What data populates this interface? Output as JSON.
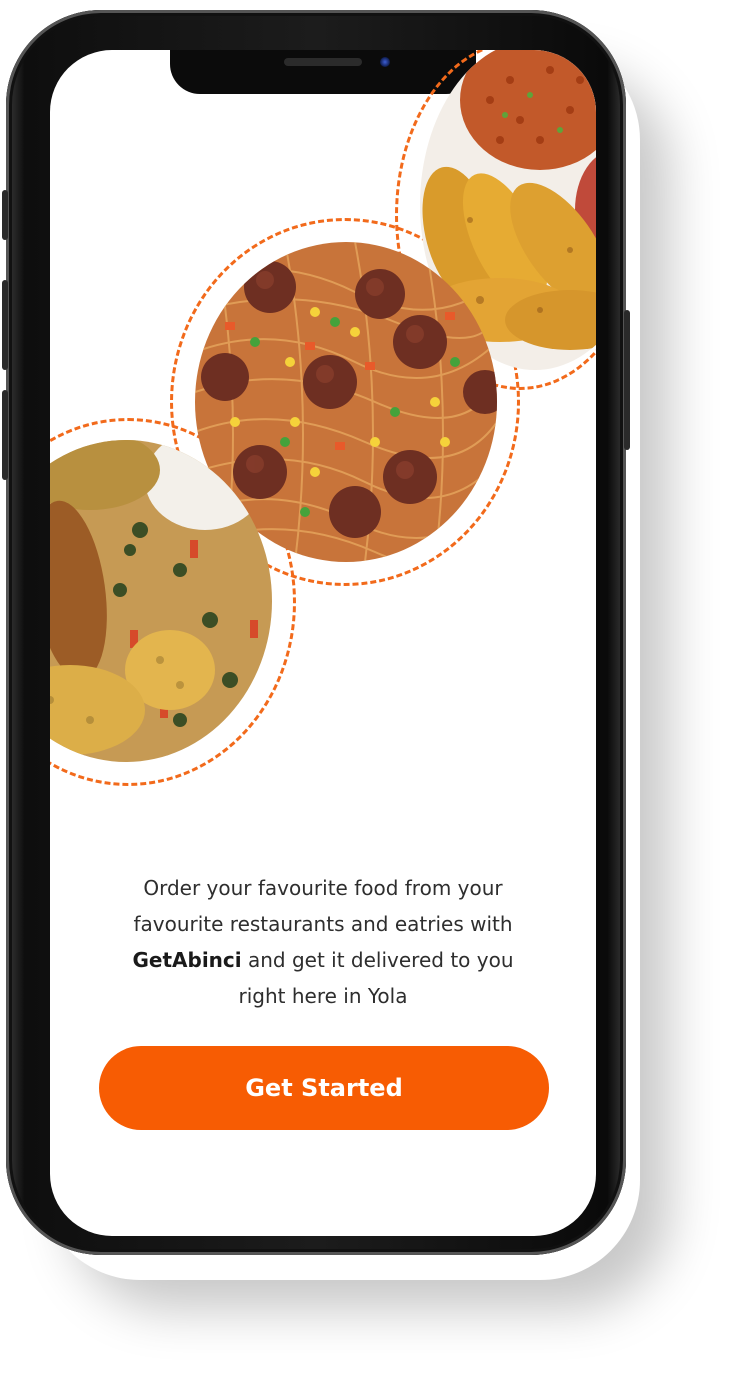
{
  "onboarding": {
    "description_part1": "Order your favourite food from your favourite restaurants and eatries with ",
    "brand_name": "GetAbinci",
    "description_part2": " and get it delivered to you right here in Yola",
    "cta_label": "Get Started"
  },
  "colors": {
    "accent": "#f75c03",
    "dash": "#f26a1b"
  },
  "images": [
    {
      "name": "jollof-rice-plantain-image"
    },
    {
      "name": "spaghetti-meatballs-image"
    },
    {
      "name": "egusi-soup-image"
    }
  ]
}
